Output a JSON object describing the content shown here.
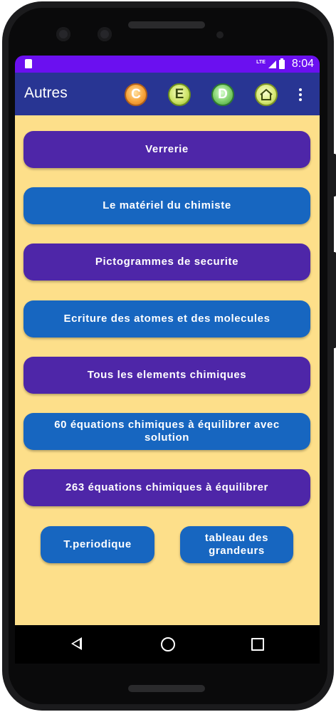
{
  "status": {
    "network": "LTE",
    "time": "8:04"
  },
  "appbar": {
    "title": "Autres",
    "icons": [
      {
        "name": "course-c-icon",
        "letter": "C"
      },
      {
        "name": "exercise-e-icon",
        "letter": "E"
      },
      {
        "name": "document-d-icon",
        "letter": "D"
      },
      {
        "name": "home-icon"
      }
    ]
  },
  "menu": {
    "items": [
      {
        "label": "Verrerie"
      },
      {
        "label": "Le matériel du chimiste"
      },
      {
        "label": "Pictogrammes de securite"
      },
      {
        "label": "Ecriture des atomes et des molecules"
      },
      {
        "label": "Tous les elements chimiques"
      },
      {
        "label": "60 équations chimiques à équilibrer avec solution"
      },
      {
        "label": "263 équations chimiques à équilibrer"
      }
    ],
    "periodic_table_label": "T.periodique",
    "quantities_table_label": "tableau des grandeurs"
  },
  "colors": {
    "status_bar": "#6b10f0",
    "app_bar": "#283593",
    "background": "#fddf8a",
    "button_purple": "#4e26a8",
    "button_blue": "#1766c0"
  }
}
